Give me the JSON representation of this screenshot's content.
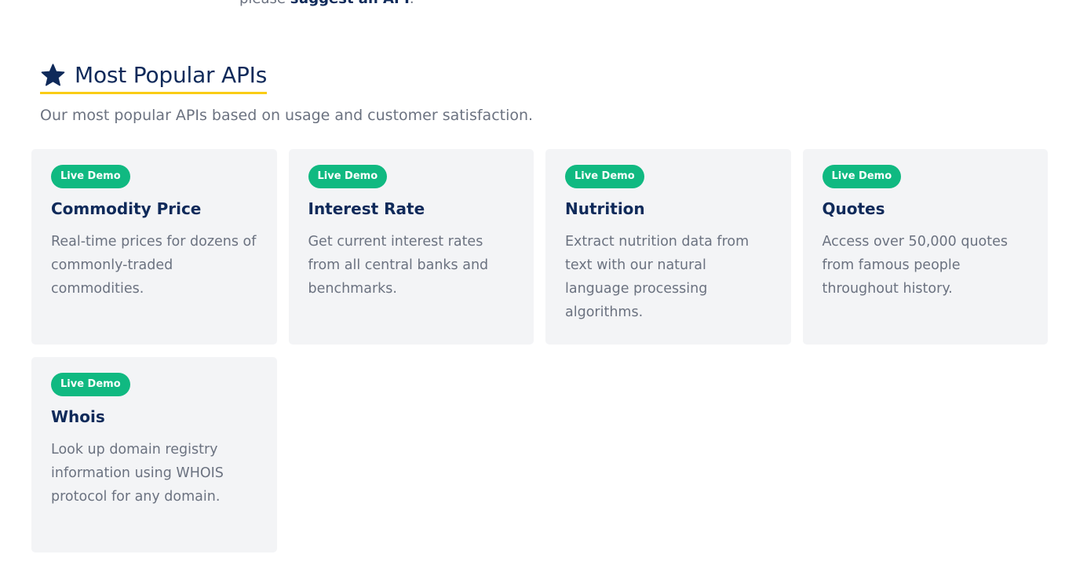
{
  "top": {
    "prefix": "please ",
    "link": "suggest an API",
    "suffix": "."
  },
  "section": {
    "title": "Most Popular APIs",
    "icon": "star-icon",
    "subtitle": "Our most popular APIs based on usage and customer satisfaction."
  },
  "colors": {
    "accent": "#facc15",
    "badge": "#10b981",
    "title": "#0f2a5a",
    "card_bg": "#f3f4f6"
  },
  "cards": [
    {
      "badge": "Live Demo",
      "title": "Commodity Price",
      "description": "Real-time prices for dozens of commonly-traded commodities."
    },
    {
      "badge": "Live Demo",
      "title": "Interest Rate",
      "description": "Get current interest rates from all central banks and benchmarks."
    },
    {
      "badge": "Live Demo",
      "title": "Nutrition",
      "description": "Extract nutrition data from text with our natural language processing algorithms."
    },
    {
      "badge": "Live Demo",
      "title": "Quotes",
      "description": "Access over 50,000 quotes from famous people throughout history."
    },
    {
      "badge": "Live Demo",
      "title": "Whois",
      "description": "Look up domain registry information using WHOIS protocol for any domain."
    }
  ]
}
